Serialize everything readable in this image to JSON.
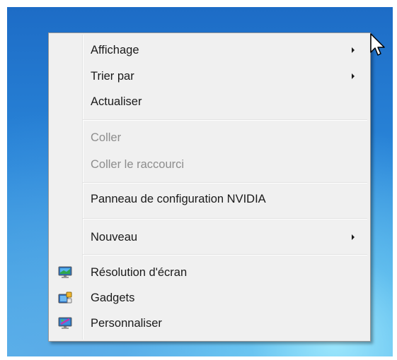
{
  "context_menu": {
    "items": [
      {
        "label": "Affichage",
        "enabled": true,
        "has_submenu": true
      },
      {
        "label": "Trier par",
        "enabled": true,
        "has_submenu": true
      },
      {
        "label": "Actualiser",
        "enabled": true,
        "has_submenu": false
      },
      {
        "label": "Coller",
        "enabled": false,
        "has_submenu": false
      },
      {
        "label": "Coller le raccourci",
        "enabled": false,
        "has_submenu": false
      },
      {
        "label": "Panneau de configuration NVIDIA",
        "enabled": true,
        "has_submenu": false
      },
      {
        "label": "Nouveau",
        "enabled": true,
        "has_submenu": true
      },
      {
        "label": "Résolution d'écran",
        "enabled": true,
        "has_submenu": false,
        "icon": "screen-resolution-icon"
      },
      {
        "label": "Gadgets",
        "enabled": true,
        "has_submenu": false,
        "icon": "gadgets-icon"
      },
      {
        "label": "Personnaliser",
        "enabled": true,
        "has_submenu": false,
        "icon": "personalize-icon"
      }
    ]
  },
  "colors": {
    "menu_background": "#f0f0f0",
    "menu_border": "#979797",
    "enabled_text": "#1a1a1a",
    "disabled_text": "#8d8d8d",
    "desktop_blue": "#2a86d9"
  }
}
